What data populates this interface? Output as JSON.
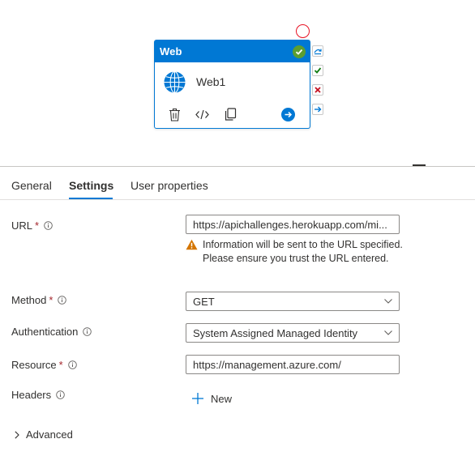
{
  "activity": {
    "type_title": "Web",
    "name": "Web1"
  },
  "tabs": [
    {
      "label": "General"
    },
    {
      "label": "Settings"
    },
    {
      "label": "User properties"
    }
  ],
  "active_tab": "Settings",
  "form": {
    "url": {
      "label": "URL",
      "required_mark": "*",
      "value": "https://apichallenges.herokuapp.com/mi..."
    },
    "warning": "Information will be sent to the URL specified. Please ensure you trust the URL entered.",
    "method": {
      "label": "Method",
      "required_mark": "*",
      "value": "GET"
    },
    "authentication": {
      "label": "Authentication",
      "value": "System Assigned Managed Identity"
    },
    "resource": {
      "label": "Resource",
      "required_mark": "*",
      "value": "https://management.azure.com/"
    },
    "headers": {
      "label": "Headers",
      "new_label": "New"
    },
    "advanced_label": "Advanced"
  },
  "colors": {
    "accent": "#0078d4",
    "success": "#5c9e31",
    "failure": "#c50f1f",
    "warning": "#d47500",
    "required": "#a4262c"
  }
}
